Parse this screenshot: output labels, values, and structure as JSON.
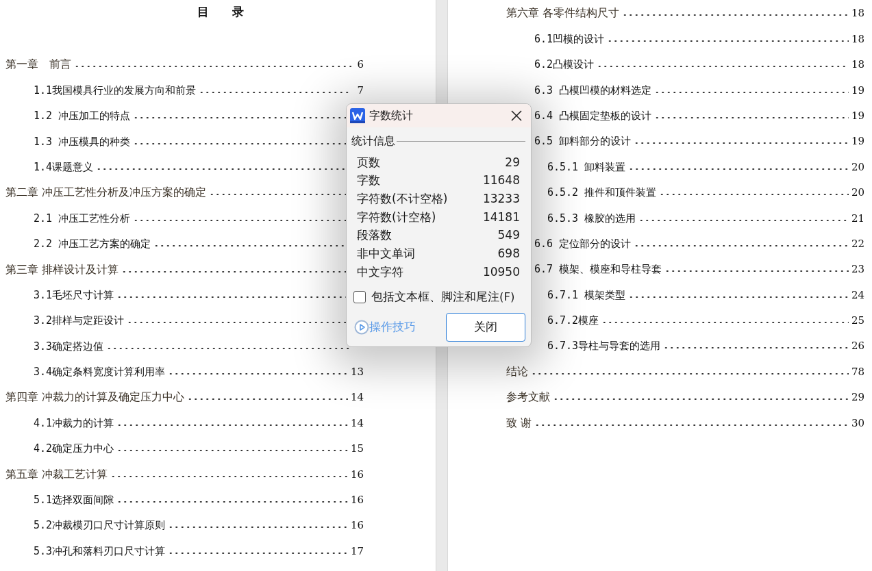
{
  "document": {
    "left_page": {
      "heading": "目　　录",
      "entries": [
        {
          "title": "第一章　前言",
          "page": "6",
          "children": [
            {
              "title": "1.1我国模具行业的发展方向和前景",
              "page": "7"
            },
            {
              "title": "1.2 冲压加工的特点"
            },
            {
              "title": "1.3 冲压模具的种类"
            },
            {
              "title": "1.4课题意义"
            }
          ]
        },
        {
          "title": "第二章 冲压工艺性分析及冲压方案的确定",
          "children": [
            {
              "title": "2.1 冲压工艺性分析"
            },
            {
              "title": "2.2 冲压工艺方案的确定"
            }
          ]
        },
        {
          "title": "第三章 排样设计及计算",
          "children": [
            {
              "title": "3.1毛坯尺寸计算"
            },
            {
              "title": "3.2排样与定距设计"
            },
            {
              "title": "3.3确定搭边值"
            },
            {
              "title": "3.4确定条料宽度计算利用率",
              "page": "13"
            }
          ]
        },
        {
          "title": "第四章 冲裁力的计算及确定压力中心",
          "page": "14",
          "children": [
            {
              "title": "4.1冲裁力的计算",
              "page": "14"
            },
            {
              "title": "4.2确定压力中心",
              "page": "15"
            }
          ]
        },
        {
          "title": "第五章 冲裁工艺计算",
          "page": "16",
          "children": [
            {
              "title": "5.1选择双面间隙",
              "page": "16"
            },
            {
              "title": "5.2冲裁模刃口尺寸计算原则",
              "page": "16"
            },
            {
              "title": "5.3冲孔和落料刃口尺寸计算",
              "page": "17"
            }
          ]
        }
      ]
    },
    "right_page": {
      "entries": [
        {
          "title": "第六章 各零件结构尺寸",
          "page": "18",
          "children": [
            {
              "title": "6.1凹模的设计",
              "page": "18"
            },
            {
              "title": "6.2凸模设计",
              "page": "18"
            },
            {
              "title": "6.3 凸模凹模的材料选定",
              "page": "19"
            },
            {
              "title": "6.4 凸模固定垫板的设计",
              "page": "19"
            },
            {
              "title": "6.5 卸料部分的设计",
              "page": "19",
              "children": [
                {
                  "title": "6.5.1 卸料装置",
                  "page": "20"
                },
                {
                  "title": "6.5.2 推件和顶件装置",
                  "page": "20"
                },
                {
                  "title": "6.5.3 橡胶的选用",
                  "page": "21"
                }
              ]
            },
            {
              "title": "6.6 定位部分的设计",
              "page": "22"
            },
            {
              "title": "6.7 模架、模座和导柱导套",
              "page": "23",
              "children": [
                {
                  "title": "6.7.1 模架类型",
                  "page": "24"
                },
                {
                  "title": "6.7.2模座",
                  "page": "25"
                },
                {
                  "title": "6.7.3导柱与导套的选用",
                  "page": "26"
                }
              ]
            }
          ]
        },
        {
          "title": "结论",
          "page": "78"
        },
        {
          "title": "参考文献",
          "page": "29"
        },
        {
          "title": "致 谢",
          "page": "30"
        }
      ]
    }
  },
  "dialog": {
    "title": "字数统计",
    "section": "统计信息",
    "stats": [
      {
        "label": "页数",
        "value": "29"
      },
      {
        "label": "字数",
        "value": "11648"
      },
      {
        "label": "字符数(不计空格)",
        "value": "13233"
      },
      {
        "label": "字符数(计空格)",
        "value": "14181"
      },
      {
        "label": "段落数",
        "value": "549"
      },
      {
        "label": "非中文单词",
        "value": "698"
      },
      {
        "label": "中文字符",
        "value": "10950"
      }
    ],
    "checkbox": {
      "label": "包括文本框、脚注和尾注(F)",
      "checked": false
    },
    "tips_link": "操作技巧",
    "close_button": "关闭"
  }
}
